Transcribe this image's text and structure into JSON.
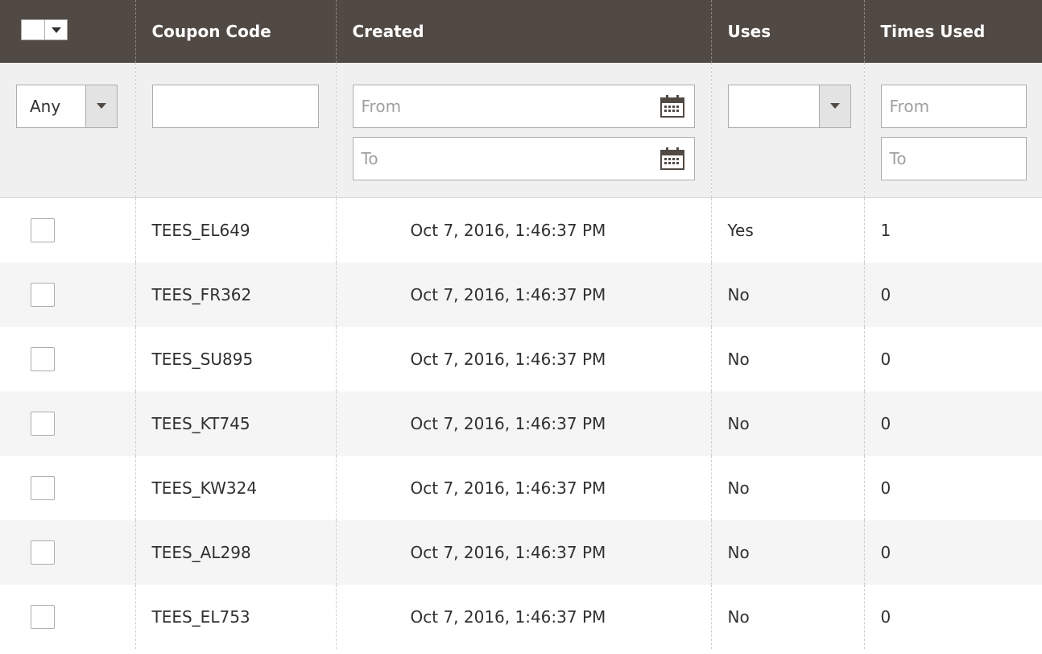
{
  "columns": {
    "coupon_code": "Coupon Code",
    "created": "Created",
    "uses": "Uses",
    "times_used": "Times Used"
  },
  "filters": {
    "any_select": "Any",
    "coupon_code_value": "",
    "created_from_placeholder": "From",
    "created_to_placeholder": "To",
    "uses_select": "",
    "times_from_placeholder": "From",
    "times_to_placeholder": "To"
  },
  "rows": [
    {
      "code": "TEES_EL649",
      "created": "Oct 7, 2016, 1:46:37 PM",
      "uses": "Yes",
      "times": "1"
    },
    {
      "code": "TEES_FR362",
      "created": "Oct 7, 2016, 1:46:37 PM",
      "uses": "No",
      "times": "0"
    },
    {
      "code": "TEES_SU895",
      "created": "Oct 7, 2016, 1:46:37 PM",
      "uses": "No",
      "times": "0"
    },
    {
      "code": "TEES_KT745",
      "created": "Oct 7, 2016, 1:46:37 PM",
      "uses": "No",
      "times": "0"
    },
    {
      "code": "TEES_KW324",
      "created": "Oct 7, 2016, 1:46:37 PM",
      "uses": "No",
      "times": "0"
    },
    {
      "code": "TEES_AL298",
      "created": "Oct 7, 2016, 1:46:37 PM",
      "uses": "No",
      "times": "0"
    },
    {
      "code": "TEES_EL753",
      "created": "Oct 7, 2016, 1:46:37 PM",
      "uses": "No",
      "times": "0"
    }
  ],
  "colors": {
    "header_bg": "#514943",
    "filter_bg": "#f0f0f0",
    "alt_row_bg": "#f5f5f5"
  }
}
